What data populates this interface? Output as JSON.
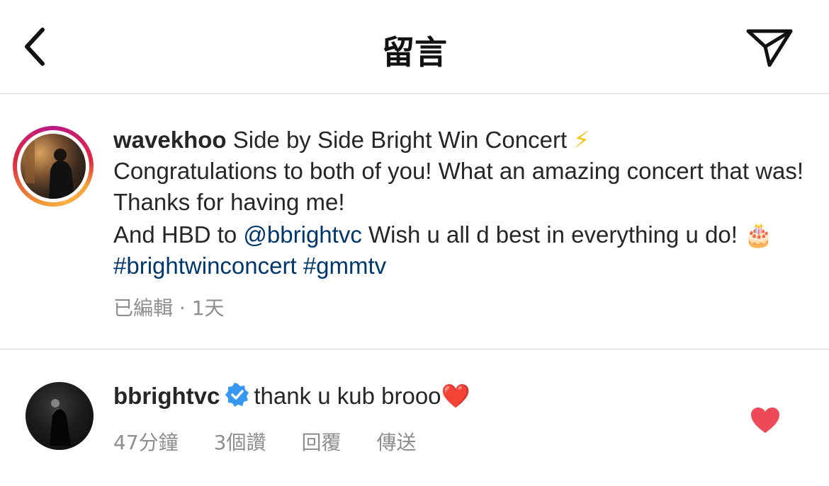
{
  "header": {
    "title": "留言",
    "back_icon": "chevron-left-icon",
    "share_icon": "paper-plane-icon"
  },
  "post": {
    "username": "wavekhoo",
    "line1": " Side by Side Bright Win Concert ",
    "emoji_bolt": "⚡",
    "line2": "Congratulations to both of you! What an amazing concert that was! Thanks for having me!",
    "line3_prefix": "And HBD to ",
    "mention": "@bbrightvc",
    "line3_suffix": " Wish u all d best in everything u do! ",
    "emoji_cake": "🎂",
    "hashtag1": "#brightwinconcert",
    "hashtag2": "#gmmtv",
    "meta": "已編輯 · 1天",
    "story_ring_colors": [
      "#f09433",
      "#dc2743",
      "#bc1888",
      "#fcb045"
    ]
  },
  "comment": {
    "username": "bbrightvc",
    "verified_color": "#3897f0",
    "text": "thank u kub brooo",
    "emoji_heart": "❤️",
    "time": "47分鐘",
    "likes": "3個讚",
    "reply": "回覆",
    "send": "傳送",
    "liked_color": "#ed4956"
  }
}
